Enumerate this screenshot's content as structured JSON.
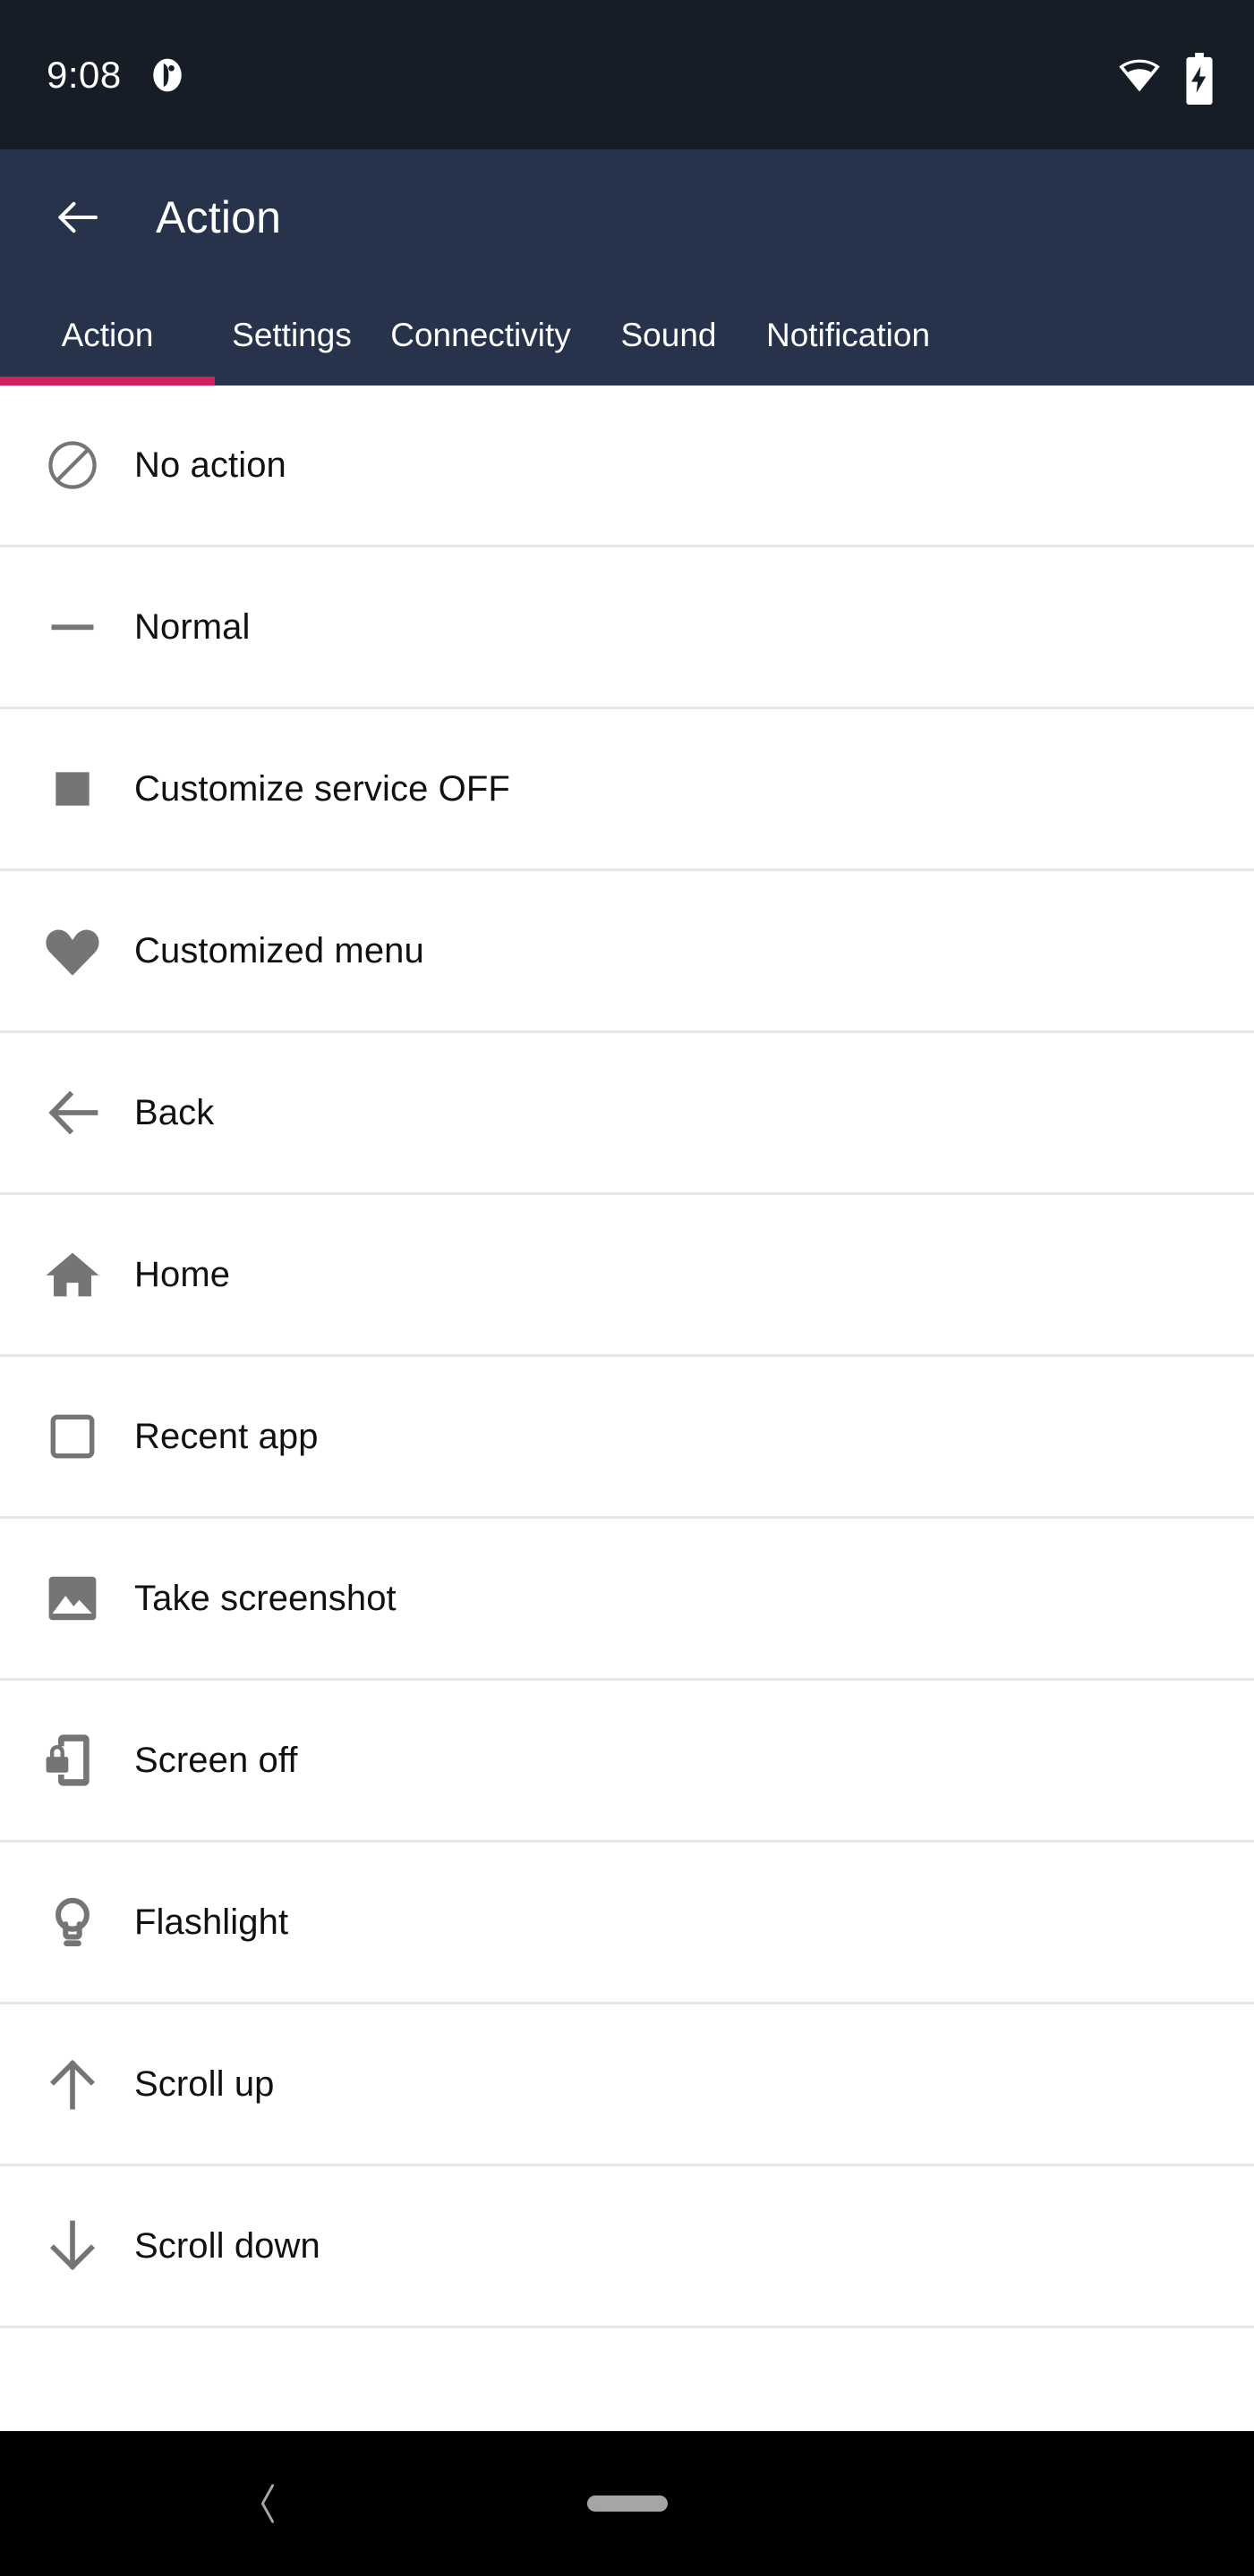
{
  "status_bar": {
    "time": "9:08",
    "icons": [
      "notification-dot-icon",
      "wifi-icon",
      "battery-charging-icon"
    ],
    "background": "#161d26"
  },
  "app_bar": {
    "back_icon": "arrow-left-icon",
    "title": "Action",
    "background": "#26334a"
  },
  "tabs": {
    "active_index": 0,
    "indicator_color": "#d11f5f",
    "items": [
      {
        "label": "Action"
      },
      {
        "label": "Settings"
      },
      {
        "label": "Connectivity"
      },
      {
        "label": "Sound"
      },
      {
        "label": "Notification"
      }
    ]
  },
  "action_list": {
    "items": [
      {
        "label": "No action",
        "icon": "block-icon"
      },
      {
        "label": "Normal",
        "icon": "dash-icon"
      },
      {
        "label": "Customize service OFF",
        "icon": "filled-square-icon"
      },
      {
        "label": "Customized menu",
        "icon": "heart-icon"
      },
      {
        "label": "Back",
        "icon": "arrow-left-icon"
      },
      {
        "label": "Home",
        "icon": "home-icon"
      },
      {
        "label": "Recent app",
        "icon": "square-outline-icon"
      },
      {
        "label": "Take screenshot",
        "icon": "image-icon"
      },
      {
        "label": "Screen off",
        "icon": "phone-lock-icon"
      },
      {
        "label": "Flashlight",
        "icon": "lightbulb-icon"
      },
      {
        "label": "Scroll up",
        "icon": "arrow-up-icon"
      },
      {
        "label": "Scroll down",
        "icon": "arrow-down-icon"
      }
    ]
  },
  "nav_bar": {
    "back_icon": "chevron-left-icon",
    "home_handle": "gesture-pill",
    "background": "#000000"
  }
}
